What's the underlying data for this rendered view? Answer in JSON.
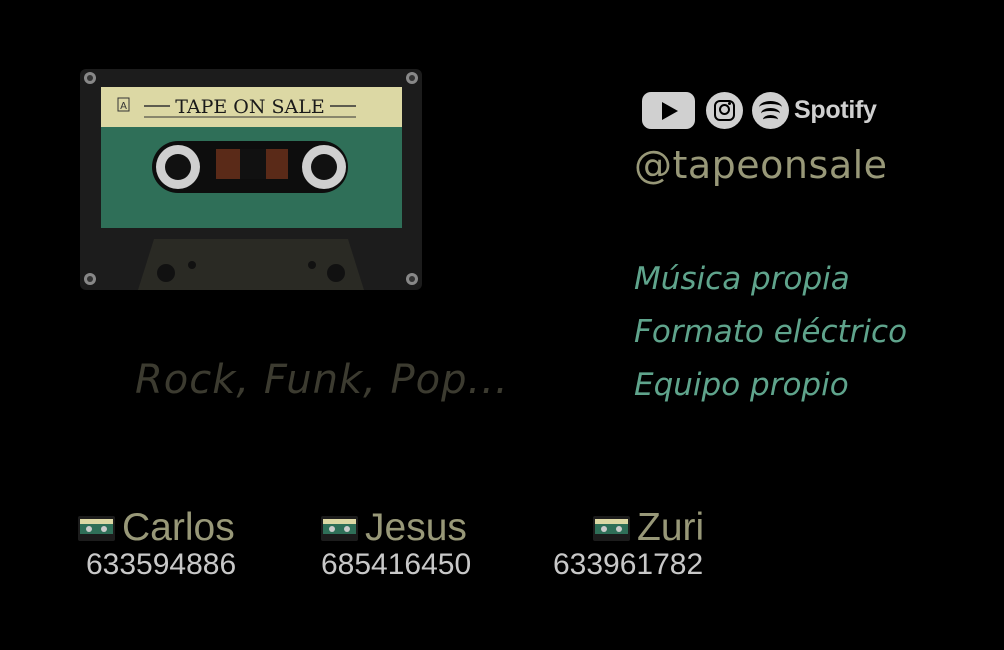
{
  "cassette": {
    "label": "TAPE ON SALE",
    "side": "A"
  },
  "social": {
    "icons": [
      "youtube-icon",
      "instagram-icon",
      "spotify-icon"
    ],
    "spotify_text": "Spotify",
    "handle": "@tapeonsale"
  },
  "features": [
    "Música propia",
    "Formato eléctrico",
    "Equipo propio"
  ],
  "genres": "Rock, Funk, Pop...",
  "members": [
    {
      "name": "Carlos",
      "phone": "633594886"
    },
    {
      "name": "Jesus",
      "phone": "685416450"
    },
    {
      "name": "Zuri",
      "phone": "633961782"
    }
  ],
  "colors": {
    "background": "#000000",
    "handle": "#989878",
    "features": "#5fa48c",
    "genres": "#3c3b30",
    "tape_green": "#2f6f58",
    "tape_label": "#dcd8a4"
  }
}
